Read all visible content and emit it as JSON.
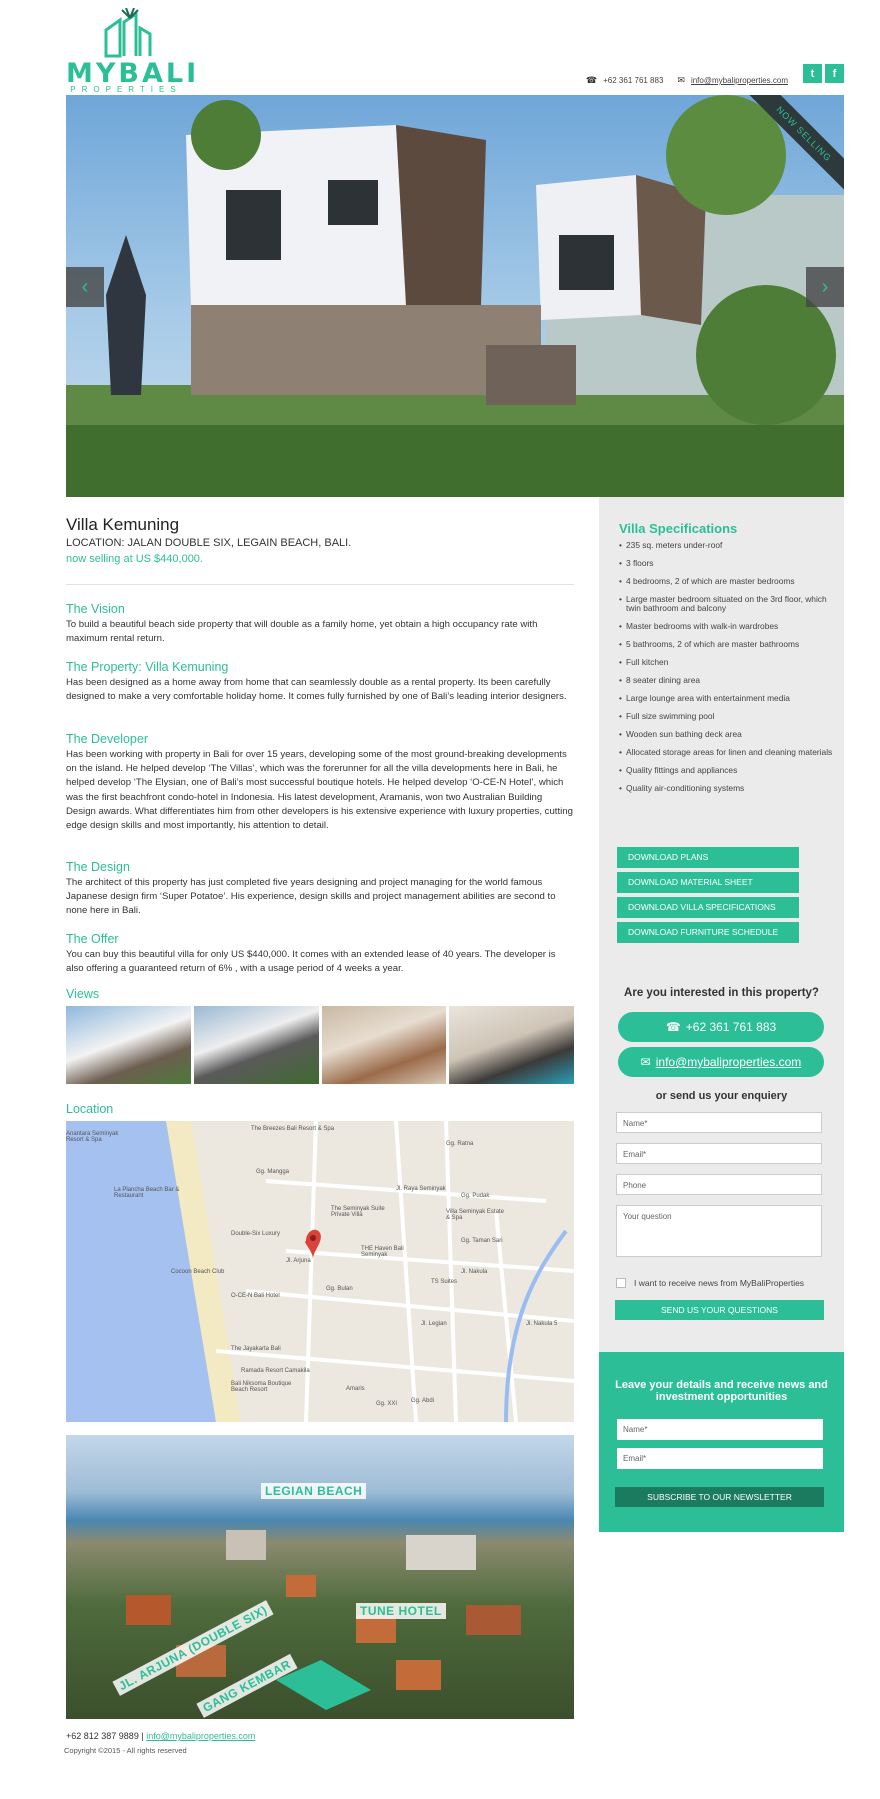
{
  "header": {
    "logo_text": "MYBALI",
    "logo_sub": "PROPERTIES",
    "phone": "+62 361 761 883",
    "email": "info@mybaliproperties.com",
    "social": [
      "twitter-icon",
      "facebook-icon"
    ],
    "twitter_glyph": "t",
    "facebook_glyph": "f"
  },
  "hero": {
    "ribbon": "NOW SELLING",
    "prev": "‹",
    "next": "›"
  },
  "property": {
    "title": "Villa Kemuning",
    "location": "LOCATION: JALAN DOUBLE SIX, LEGAIN BEACH, BALI.",
    "price": "now selling at US $440,000."
  },
  "sections": [
    {
      "heading": "The Vision",
      "body": "To build a beautiful beach side property that will double as a family home, yet obtain a high occupancy rate with maximum rental return."
    },
    {
      "heading": "The Property: Villa Kemuning",
      "body": "Has been designed as a home away from home that can seamlessly double as a rental property. Its been  carefully designed to make a very comfortable holiday home. It comes fully furnished by one of Bali’s leading interior designers."
    },
    {
      "heading": "The Developer",
      "body": "Has been working with property in Bali for over 15 years, developing some of the most ground-breaking developments on the island. He helped develop ‘The Villas’, which was the forerunner for all the villa developments here in Bali, he helped develop ‘The Elysian, one of Bali’s most successful boutique hotels. He helped develop ‘O-CE-N Hotel’, which was the first beachfront condo-hotel in Indonesia. His latest development, Aramanis, won two Australian Building Design awards. What differentiates him from other developers is his extensive experience with luxury properties, cutting edge design skills and most importantly, his attention to detail."
    },
    {
      "heading": "The Design",
      "body": "The architect of this property has just completed five years designing and project managing for the world famous Japanese design firm ‘Super Potatoe’. His experience, design skills and project management abilities are second to none here in Bali."
    },
    {
      "heading": "The Offer",
      "body": "You can buy this beautiful villa for only US $440,000. It comes with an extended lease of 40 years. The developer is also offering a guaranteed return of 6% , with a usage period of 4 weeks a year."
    }
  ],
  "views_heading": "Views",
  "location_heading": "Location",
  "map_labels": [
    "The Breezes Bali Resort & Spa",
    "Anantara Seminyak Resort & Spa",
    "Gg. Mangga",
    "La Plancha Beach Bar & Restaurant",
    "The Seminyak Suite Private Villa",
    "Gg. Pudak",
    "Villa Seminyak Estate & Spa",
    "Double-Six Luxury",
    "THE Haven Bali Seminyak",
    "Gg. Taman Sari",
    "Jl. Arjuna",
    "Jl. Nakula",
    "Cocoon Beach Club",
    "TS Suites",
    "Gg. Bulan",
    "O-CE-N Bali Hotel",
    "The Jayakarta Bali",
    "Ramada Resort Camakila",
    "Bali Niksoma Boutique Beach Resort",
    "Jl. Legian",
    "Gg. Abdi",
    "Amaris",
    "Gg. XXI",
    "Jl. Raya Seminyak",
    "Gg. Ratna",
    "Jl. Nakula 5"
  ],
  "aerial_labels": {
    "beach": "LEGIAN BEACH",
    "hotel": "TUNE HOTEL",
    "road1": "JL. ARJUNA (DOUBLE SIX)",
    "road2": "GANG KEMBAR"
  },
  "footer": {
    "phone": "+62 812 387 9889",
    "separator": "|",
    "email": "info@mybaliproperties.com",
    "copyright": "Copyright ©2015 - All rights reserved"
  },
  "specs": {
    "heading": "Villa Specifications",
    "items": [
      "235 sq. meters under-roof",
      "3 floors",
      "4 bedrooms, 2 of which are master bedrooms",
      "Large master bedroom situated on the 3rd floor, which twin bathroom  and balcony",
      "Master bedrooms with walk-in wardrobes",
      "5 bathrooms, 2 of which are master bathrooms",
      "Full kitchen",
      "8 seater dining area",
      "Large lounge area with entertainment media",
      "Full size swimming pool",
      "Wooden sun bathing deck area",
      "Allocated storage areas for linen and cleaning materials",
      "Quality fittings and appliances",
      "Quality air-conditioning systems"
    ],
    "buttons": [
      "DOWNLOAD PLANS",
      "DOWNLOAD MATERIAL SHEET",
      "DOWNLOAD VILLA SPECIFICATIONS",
      "DOWNLOAD FURNITURE SCHEDULE"
    ]
  },
  "enquiry": {
    "question": "Are you interested in this property?",
    "phone": "+62 361 761 883",
    "email": "info@mybaliproperties.com",
    "or_text": "or send us your enquiery",
    "name_ph": "Name*",
    "email_ph": "Email*",
    "phone_ph": "Phone",
    "question_ph": "Your question",
    "checkbox": "I want to receive news from MyBaliProperties",
    "send": "SEND US YOUR QUESTIONS"
  },
  "newsletter": {
    "title": "Leave your details and receive news and investment opportunities",
    "name_ph": "Name*",
    "email_ph": "Email*",
    "button": "SUBSCRIBE TO OUR NEWSLETTER"
  },
  "colors": {
    "accent": "#2cbf97",
    "panel": "#ebebeb",
    "dark_button": "#1b7b5f"
  }
}
